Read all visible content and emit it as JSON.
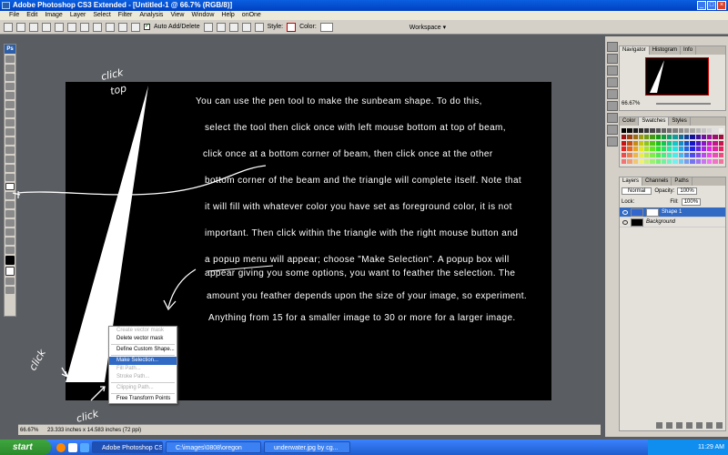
{
  "titlebar": {
    "title": "Adobe Photoshop CS3 Extended - [Untitled-1 @ 66.7% (RGB/8)]"
  },
  "menubar": {
    "items": [
      "File",
      "Edit",
      "Image",
      "Layer",
      "Select",
      "Filter",
      "Analysis",
      "View",
      "Window",
      "Help",
      "onOne"
    ]
  },
  "options": {
    "auto_add_delete": "Auto Add/Delete",
    "style_label": "Style:",
    "color_label": "Color:",
    "workspace": "Workspace ▾"
  },
  "instructions": [
    "You can use the pen tool to make the sunbeam shape. To do this,",
    "select the tool then click once with left mouse bottom at top of beam,",
    "click once at a bottom corner of beam, then click once at the other",
    "bottom corner of the beam and the triangle will complete itself. Note that",
    "it will fill with whatever color you have set as foreground color, it is not",
    "important. Then click within the triangle with the right mouse button and",
    "a popup menu will appear; choose \"Make Selection\". A popup box will",
    "appear giving you some options, you want to feather the selection. The",
    "amount you feather depends upon the size of your image, so experiment.",
    "Anything from 15 for a smaller image to 30 or more for a larger image."
  ],
  "annotations": {
    "click_top_1": "click",
    "click_top_2": "top",
    "click_left": "click",
    "click_bottom": "click"
  },
  "context_menu": {
    "create_mask": "Create vector mask",
    "delete_mask": "Delete vector mask",
    "define_shape": "Define Custom Shape...",
    "make_selection": "Make Selection...",
    "fill_path": "Fill Path...",
    "stroke_path": "Stroke Path...",
    "clipping_path": "Clipping Path...",
    "free_transform": "Free Transform Points"
  },
  "status": {
    "zoom": "66.67%",
    "doc_size": "23.333 inches x 14.583 inches (72 ppi)"
  },
  "panels": {
    "navigator_tabs": [
      "Navigator",
      "Histogram",
      "Info"
    ],
    "nav_zoom": "66.67%",
    "swatch_tabs": [
      "Color",
      "Swatches",
      "Styles"
    ],
    "layers_tabs": [
      "Layers",
      "Channels",
      "Paths"
    ],
    "blend_mode": "Normal",
    "opacity_label": "Opacity:",
    "opacity": "100%",
    "lock_label": "Lock:",
    "fill_label": "Fill:",
    "fill": "100%",
    "layer1": "Shape 1",
    "layer2": "Background"
  },
  "taskbar": {
    "start": "start",
    "tasks": [
      "Adobe Photoshop CS...",
      "C:\\images\\0808\\oregon",
      "underwater.jpg by cg..."
    ],
    "time": "11:29 AM"
  },
  "colors": {
    "accent": "#316ac5",
    "canvas": "#000000",
    "shape": "#ffffff",
    "annotation": "#ffffff"
  }
}
